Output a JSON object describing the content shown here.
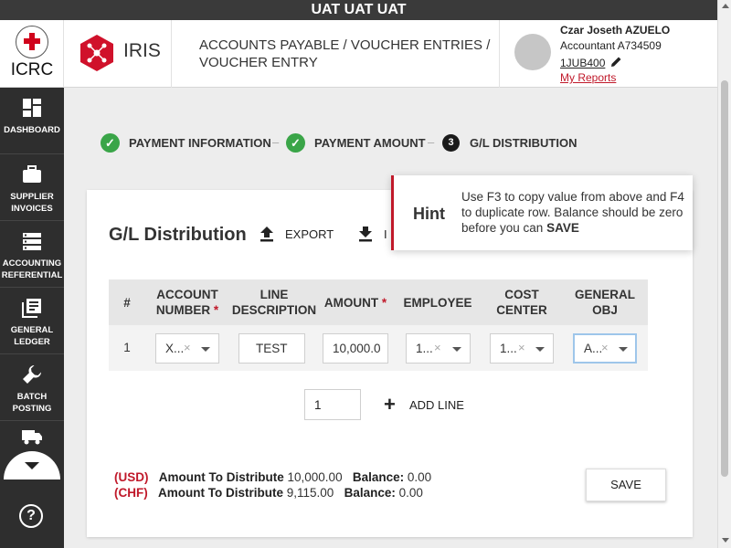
{
  "env_banner": "UAT UAT UAT",
  "header": {
    "org_logo_text": "ICRC",
    "app_name": "IRIS",
    "breadcrumb_line1": "ACCOUNTS PAYABLE / VOUCHER ENTRIES /",
    "breadcrumb_line2": "VOUCHER ENTRY",
    "user": {
      "name": "Czar Joseth AZUELO",
      "role": "Accountant A734509",
      "code": "1JUB400",
      "reports_link": "My Reports"
    }
  },
  "sidebar": {
    "items": [
      {
        "label_1": "DASHBOARD",
        "label_2": "",
        "icon": "dashboard-icon"
      },
      {
        "label_1": "SUPPLIER",
        "label_2": "INVOICES",
        "icon": "briefcase-icon"
      },
      {
        "label_1": "ACCOUNTING",
        "label_2": "REFERENTIAL",
        "icon": "list-icon"
      },
      {
        "label_1": "GENERAL",
        "label_2": "LEDGER",
        "icon": "ledger-icon"
      },
      {
        "label_1": "BATCH",
        "label_2": "POSTING",
        "icon": "wrench-icon"
      }
    ],
    "help_symbol": "?"
  },
  "stepper": {
    "steps": [
      {
        "label": "PAYMENT INFORMATION",
        "state": "done"
      },
      {
        "label": "PAYMENT AMOUNT",
        "state": "done"
      },
      {
        "label": "G/L DISTRIBUTION",
        "state": "active",
        "number": "3"
      }
    ],
    "separator": "–"
  },
  "card": {
    "title": "G/L Distribution",
    "export_label": "EXPORT",
    "import_label": "I"
  },
  "table": {
    "headers": {
      "num": "#",
      "account_1": "ACCOUNT",
      "account_2": "NUMBER",
      "line_1": "LINE",
      "line_2": "DESCRIPTION",
      "amount": "AMOUNT",
      "employee": "EMPLOYEE",
      "cost_1": "COST",
      "cost_2": "CENTER",
      "general_1": "GENERAL",
      "general_2": "OBJ",
      "required_mark": "*"
    },
    "rows": [
      {
        "num": "1",
        "account": "X...",
        "line_description": "TEST",
        "amount": "10,000.0",
        "employee": "1...",
        "cost_center": "1...",
        "general_obj": "A..."
      }
    ],
    "clear_symbol": "×"
  },
  "add_line": {
    "count_value": "1",
    "label": "ADD LINE",
    "icon_symbol": "+"
  },
  "summary": {
    "rows": [
      {
        "currency": "(USD)",
        "amount_label": "Amount To Distribute",
        "amount": "10,000.00",
        "balance_label": "Balance:",
        "balance": "0.00"
      },
      {
        "currency": "(CHF)",
        "amount_label": "Amount To Distribute",
        "amount": "9,115.00",
        "balance_label": "Balance:",
        "balance": "0.00"
      }
    ]
  },
  "save_label": "SAVE",
  "hint": {
    "title": "Hint",
    "text_part1": "Use F3 to copy value from above and F4 to duplicate row. Balance should be zero before you can ",
    "text_bold": "SAVE"
  },
  "colors": {
    "accent_red": "#c0192a",
    "success_green": "#3aa548",
    "sidebar_bg": "#2e2e2e"
  }
}
